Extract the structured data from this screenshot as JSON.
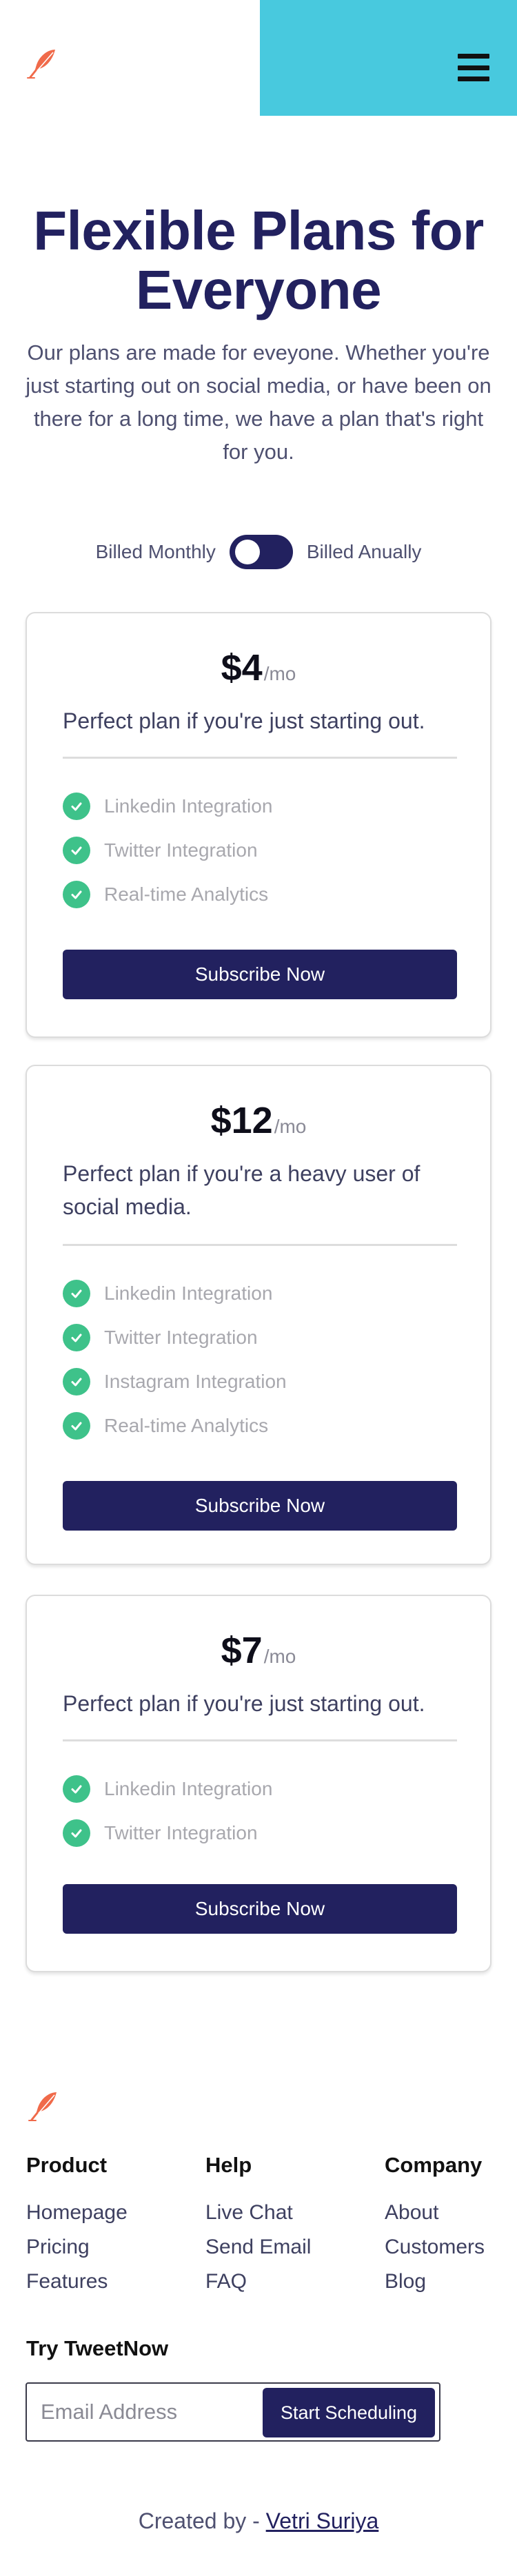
{
  "header": {
    "logo_icon": "feather-icon",
    "menu_icon": "hamburger-menu-icon",
    "accent_color": "#48c9de",
    "logo_color": "#f06a4a"
  },
  "hero": {
    "title": "Flexible Plans for Everyone",
    "description": "Our plans are made for eveyone. Whether you're just starting out on social media, or have been on there for a long time, we have a plan that's right for you."
  },
  "billing": {
    "monthly_label": "Billed Monthly",
    "annual_label": "Billed Anually",
    "selected": "Billed Monthly"
  },
  "plans": [
    {
      "price": "$4",
      "period": "/mo",
      "description": "Perfect plan if you're just starting out.",
      "features": [
        "Linkedin Integration",
        "Twitter Integration",
        "Real-time Analytics"
      ],
      "button_label": "Subscribe Now"
    },
    {
      "price": "$12",
      "period": "/mo",
      "description": "Perfect plan if you're a heavy user of social media.",
      "features": [
        "Linkedin Integration",
        "Twitter Integration",
        "Instagram Integration",
        "Real-time Analytics"
      ],
      "button_label": "Subscribe Now"
    },
    {
      "price": "$7",
      "period": "/mo",
      "description": "Perfect plan if you're just starting out.",
      "features": [
        "Linkedin Integration",
        "Twitter Integration"
      ],
      "button_label": "Subscribe Now"
    }
  ],
  "footer": {
    "columns": [
      {
        "title": "Product",
        "links": [
          "Homepage",
          "Pricing",
          "Features"
        ]
      },
      {
        "title": "Help",
        "links": [
          "Live Chat",
          "Send Email",
          "FAQ"
        ]
      },
      {
        "title": "Company",
        "links": [
          "About",
          "Customers",
          "Blog"
        ]
      }
    ],
    "try_title": "Try TweetNow",
    "email_placeholder": "Email Address",
    "cta_label": "Start Scheduling",
    "credits_prefix": "Created by - ",
    "credits_author": "Vetri Suriya"
  },
  "colors": {
    "primary": "#22215f",
    "check": "#3ec28a",
    "feature_text": "#a8a8ae"
  }
}
